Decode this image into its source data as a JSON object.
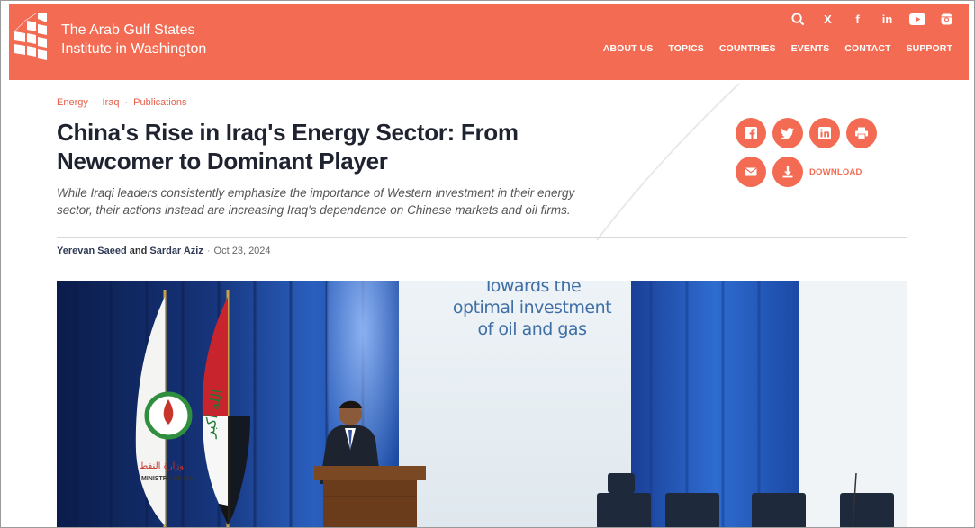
{
  "site": {
    "title_line1": "The Arab Gulf States",
    "title_line2": "Institute in Washington"
  },
  "utility_icons": [
    "search-icon",
    "x-icon",
    "facebook-icon",
    "linkedin-icon",
    "youtube-icon",
    "instagram-icon"
  ],
  "utility_glyphs": {
    "x": "X",
    "facebook": "f",
    "linkedin": "in"
  },
  "nav": {
    "items": [
      "ABOUT US",
      "TOPICS",
      "COUNTRIES",
      "EVENTS",
      "CONTACT",
      "SUPPORT"
    ]
  },
  "breadcrumb": {
    "items": [
      "Energy",
      "Iraq",
      "Publications"
    ],
    "separator": "·"
  },
  "article": {
    "title_line1": "China's Rise in Iraq's Energy Sector: From",
    "title_line2": "Newcomer to Dominant Player",
    "subtitle_line1": "While Iraqi leaders consistently emphasize the importance of Western investment in their energy",
    "subtitle_line2": "sector, their actions instead are increasing Iraq's dependence on Chinese markets and oil firms.",
    "author1": "Yerevan Saeed",
    "and": "and",
    "author2": "Sardar Aziz",
    "date_separator": "·",
    "date": "Oct 23, 2024"
  },
  "share": {
    "download_label": "DOWNLOAD",
    "icons": [
      "facebook-share-icon",
      "twitter-share-icon",
      "linkedin-share-icon",
      "print-icon",
      "email-icon",
      "download-icon"
    ]
  },
  "hero": {
    "banner_line1": "Towards the",
    "banner_line2": "optimal investment",
    "banner_line3": "of oil and gas",
    "flag_label": "MINISTRY OF OIL"
  },
  "colors": {
    "brand": "#f26b52",
    "title": "#1f2330",
    "author": "#2f3a55"
  }
}
